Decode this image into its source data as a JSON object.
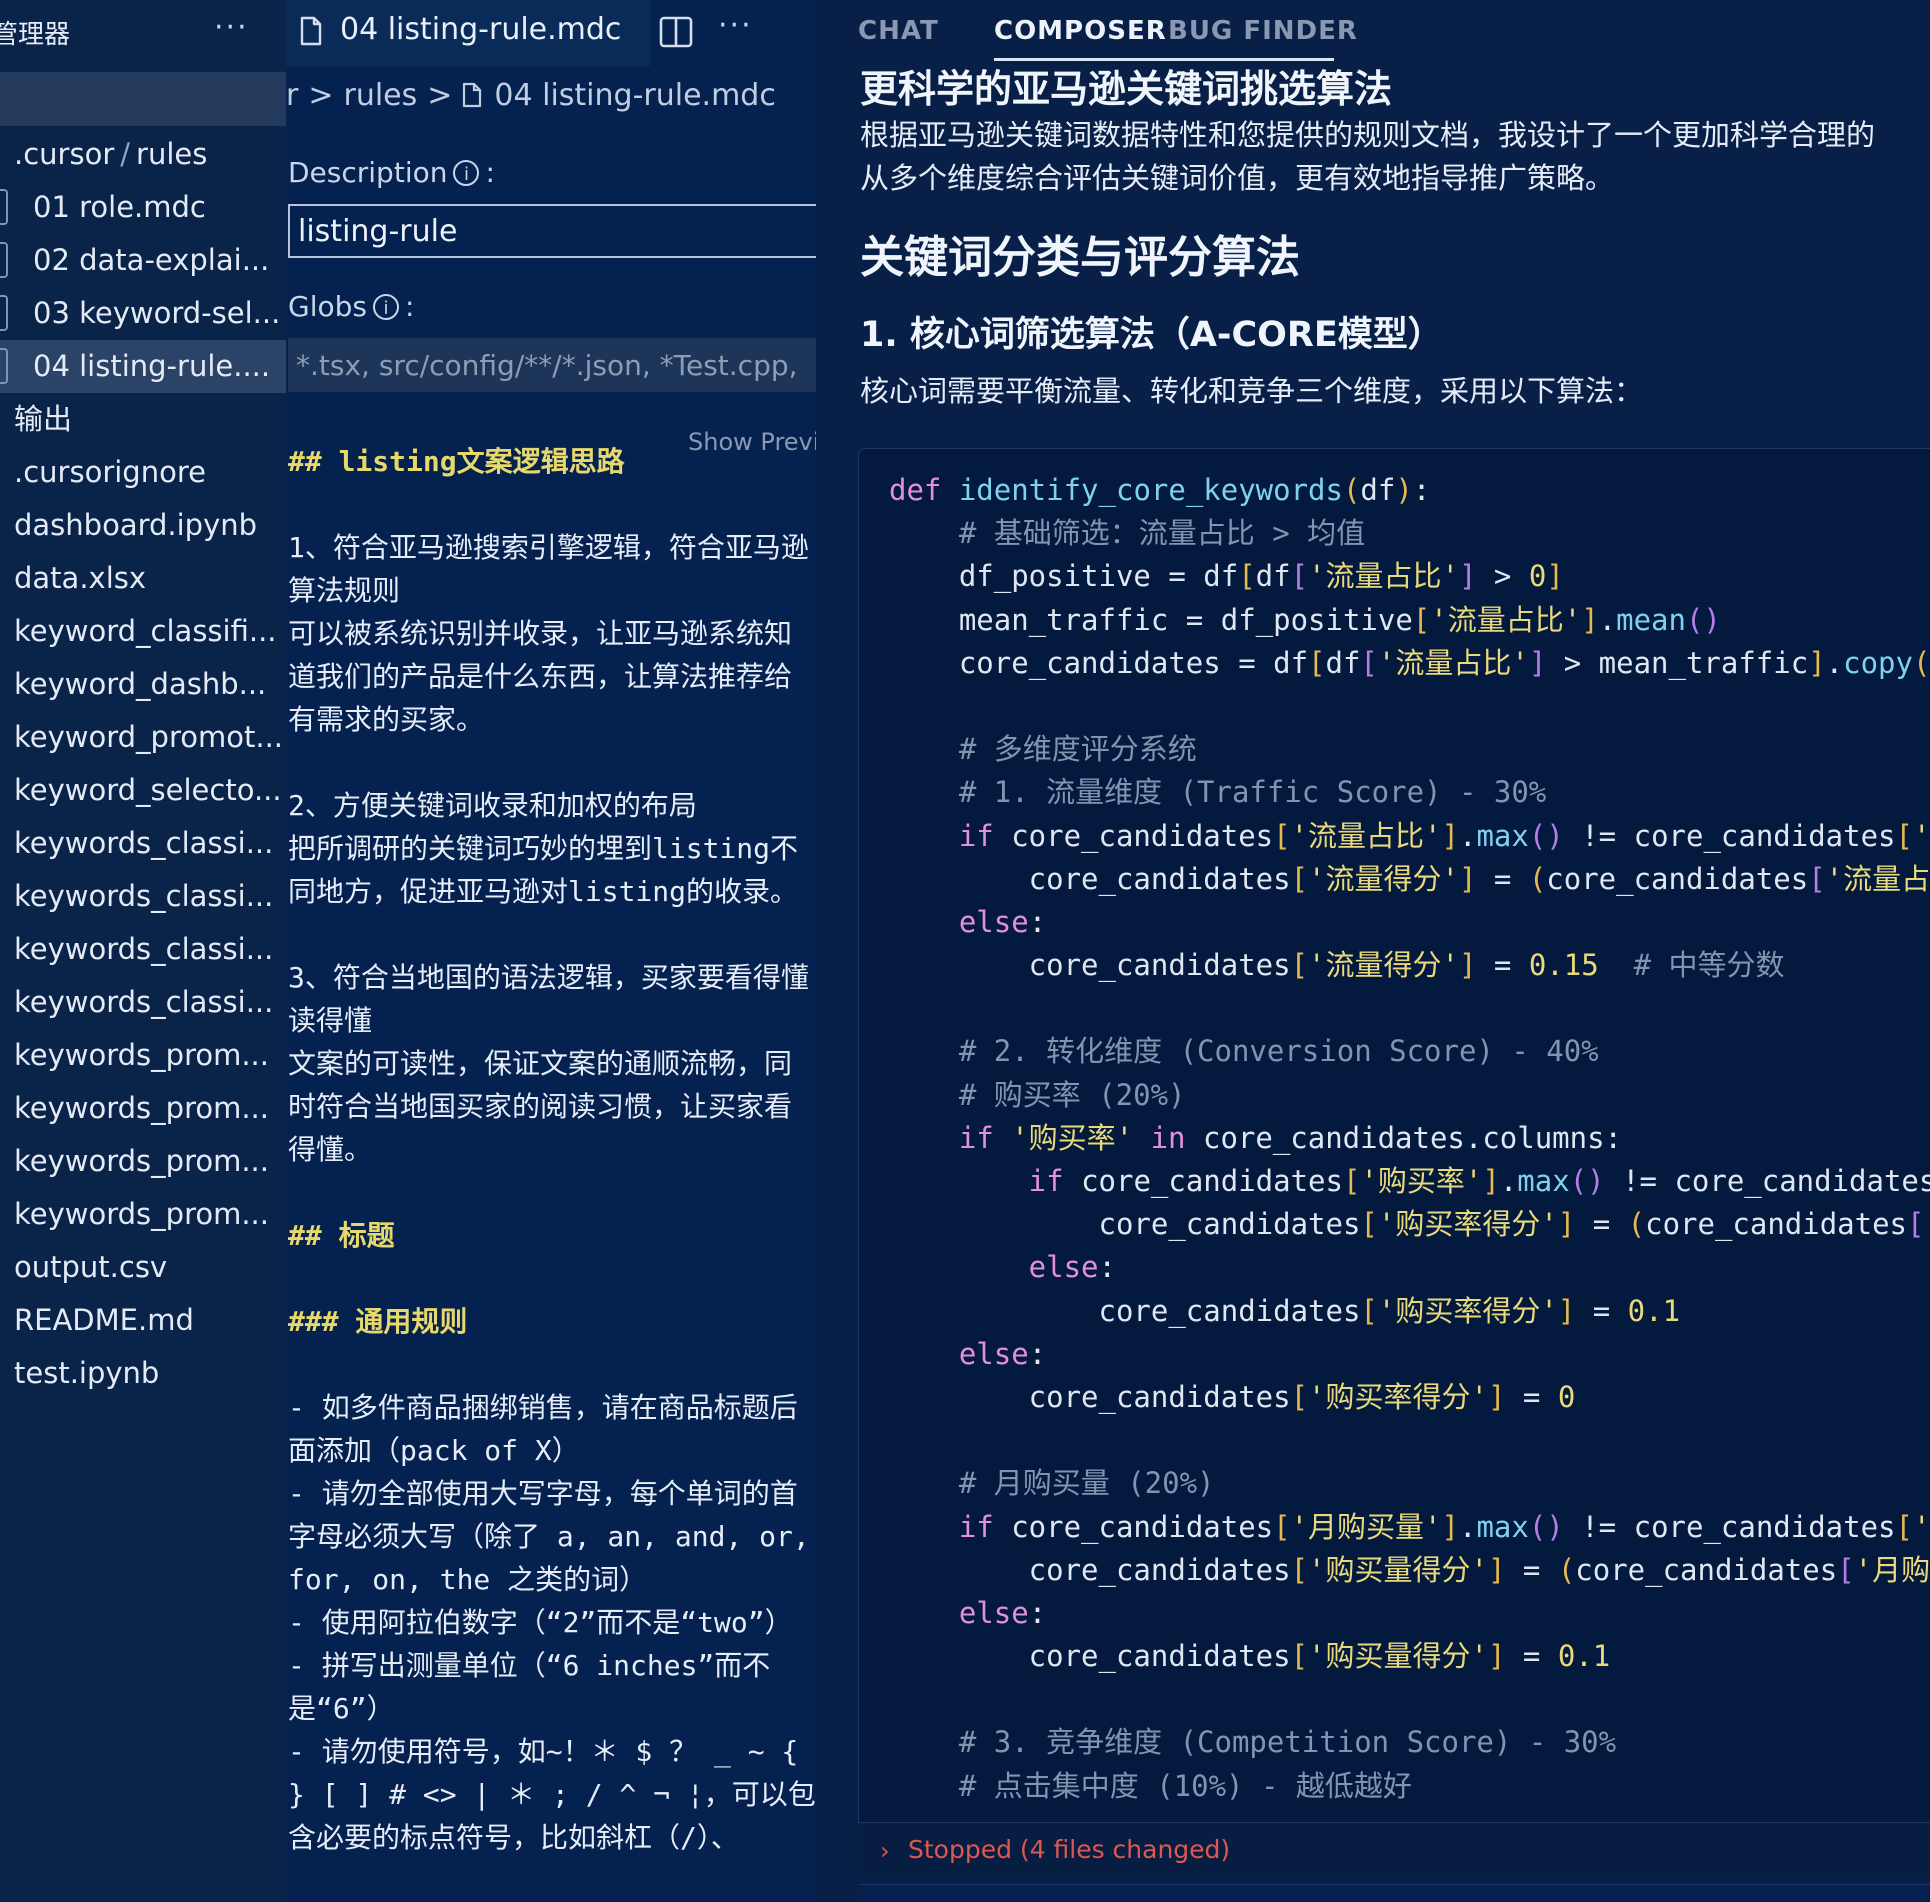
{
  "sidebar": {
    "title": "管理器",
    "more": "···",
    "tree": [
      {
        "label": ".cursor",
        "sep": "/",
        "label2": "rules",
        "type": "folder"
      },
      {
        "label": "01 role.mdc",
        "type": "child"
      },
      {
        "label": "02 data-explai...",
        "type": "child"
      },
      {
        "label": "03 keyword-sel...",
        "type": "child"
      },
      {
        "label": "04 listing-rule....",
        "type": "child",
        "selected": true
      },
      {
        "label": "输出",
        "type": "file"
      },
      {
        "label": ".cursorignore",
        "type": "file"
      },
      {
        "label": "dashboard.ipynb",
        "type": "file"
      },
      {
        "label": "data.xlsx",
        "type": "file"
      },
      {
        "label": "keyword_classifi...",
        "type": "file"
      },
      {
        "label": "keyword_dashb...",
        "type": "file"
      },
      {
        "label": "keyword_promot...",
        "type": "file"
      },
      {
        "label": "keyword_selecto...",
        "type": "file"
      },
      {
        "label": "keywords_classi...",
        "type": "file"
      },
      {
        "label": "keywords_classi...",
        "type": "file"
      },
      {
        "label": "keywords_classi...",
        "type": "file"
      },
      {
        "label": "keywords_classi...",
        "type": "file"
      },
      {
        "label": "keywords_prom...",
        "type": "file"
      },
      {
        "label": "keywords_prom...",
        "type": "file"
      },
      {
        "label": "keywords_prom...",
        "type": "file"
      },
      {
        "label": "keywords_prom...",
        "type": "file"
      },
      {
        "label": "output.csv",
        "type": "file"
      },
      {
        "label": "README.md",
        "type": "file"
      },
      {
        "label": "test.ipynb",
        "type": "file"
      }
    ]
  },
  "editor": {
    "tab_label": "04 listing-rule.mdc",
    "more": "···",
    "breadcrumb": [
      "r",
      ">",
      "rules",
      ">",
      "04 listing-rule.mdc"
    ],
    "description_label": "Description",
    "colon": ":",
    "description_value": "listing-rule",
    "globs_label": "Globs",
    "globs_placeholder": "*.tsx, src/config/**/*.json, *Test.cpp,",
    "show_preview": "Show Previ",
    "body": [
      {
        "kind": "h",
        "text": "## listing文案逻辑思路"
      },
      {
        "kind": "gap"
      },
      {
        "kind": "p",
        "text": "1、符合亚马逊搜索引擎逻辑，符合亚马逊算法规则"
      },
      {
        "kind": "p",
        "text": "可以被系统识别并收录，让亚马逊系统知道我们的产品是什么东西，让算法推荐给有需求的买家。"
      },
      {
        "kind": "gap"
      },
      {
        "kind": "p",
        "text": "2、方便关键词收录和加权的布局"
      },
      {
        "kind": "p",
        "text": "把所调研的关键词巧妙的埋到listing不同地方，促进亚马逊对listing的收录。"
      },
      {
        "kind": "gap"
      },
      {
        "kind": "p",
        "text": "3、符合当地国的语法逻辑，买家要看得懂读得懂"
      },
      {
        "kind": "p",
        "text": "文案的可读性，保证文案的通顺流畅，同时符合当地国买家的阅读习惯，让买家看得懂。"
      },
      {
        "kind": "gap"
      },
      {
        "kind": "h",
        "text": "## 标题"
      },
      {
        "kind": "gap"
      },
      {
        "kind": "h",
        "text": "### 通用规则"
      },
      {
        "kind": "gap"
      },
      {
        "kind": "p",
        "text": "- 如多件商品捆绑销售，请在商品标题后面添加（pack of X）"
      },
      {
        "kind": "p",
        "text": "- 请勿全部使用大写字母，每个单词的首字母必须大写（除了 a, an, and, or, for, on, the 之类的词）"
      },
      {
        "kind": "p",
        "text": "- 使用阿拉伯数字（“2”而不是“two”）"
      },
      {
        "kind": "p",
        "text": "- 拼写出测量单位（“6 inches”而不是“6”）"
      },
      {
        "kind": "p",
        "text": "- 请勿使用符号，如~！＊ $ ？ _ ~ { } [ ] # <> | ＊ ; / ^ ¬ ¦，可以包含必要的标点符号，比如斜杠（/）、"
      }
    ]
  },
  "panel": {
    "tabs": [
      "CHAT",
      "COMPOSER",
      "BUG FINDER"
    ],
    "active_tab": "COMPOSER",
    "title": "更科学的亚马逊关键词挑选算法",
    "intro_lines": [
      "根据亚马逊关键词数据特性和您提供的规则文档，我设计了一个更加科学合理的",
      "从多个维度综合评估关键词价值，更有效地指导推广策略。"
    ],
    "h2": "关键词分类与评分算法",
    "h3": "1. 核心词筛选算法（A-CORE模型）",
    "h3_intro": "核心词需要平衡流量、转化和竞争三个维度，采用以下算法：",
    "status": "Stopped (4 files changed)"
  },
  "code_lines": [
    [
      [
        "kw",
        "def "
      ],
      [
        "fn",
        "identify_core_keywords"
      ],
      [
        "brk",
        "("
      ],
      [
        "t",
        "df"
      ],
      [
        "brk",
        ")"
      ],
      [
        "t",
        ":"
      ]
    ],
    [
      [
        "cm",
        "    # 基础筛选：流量占比 > 均值"
      ]
    ],
    [
      [
        "t",
        "    df_positive = df"
      ],
      [
        "brk",
        "["
      ],
      [
        "t",
        "df"
      ],
      [
        "brk2",
        "["
      ],
      [
        "str",
        "'流量占比'"
      ],
      [
        "brk2",
        "]"
      ],
      [
        "t",
        " > "
      ],
      [
        "num",
        "0"
      ],
      [
        "brk",
        "]"
      ]
    ],
    [
      [
        "t",
        "    mean_traffic = df_positive"
      ],
      [
        "brk",
        "["
      ],
      [
        "str",
        "'流量占比'"
      ],
      [
        "brk",
        "]"
      ],
      [
        "t",
        "."
      ],
      [
        "fn",
        "mean"
      ],
      [
        "brk2",
        "()"
      ]
    ],
    [
      [
        "t",
        "    core_candidates = df"
      ],
      [
        "brk",
        "["
      ],
      [
        "t",
        "df"
      ],
      [
        "brk2",
        "["
      ],
      [
        "str",
        "'流量占比'"
      ],
      [
        "brk2",
        "]"
      ],
      [
        "t",
        " > mean_traffic"
      ],
      [
        "brk",
        "]"
      ],
      [
        "t",
        "."
      ],
      [
        "fn",
        "copy"
      ],
      [
        "brk",
        "("
      ]
    ],
    [
      [
        "t",
        ""
      ]
    ],
    [
      [
        "cm",
        "    # 多维度评分系统"
      ]
    ],
    [
      [
        "cm",
        "    # 1. 流量维度 (Traffic Score) - 30%"
      ]
    ],
    [
      [
        "kw",
        "    if "
      ],
      [
        "t",
        "core_candidates"
      ],
      [
        "brk",
        "["
      ],
      [
        "str",
        "'流量占比'"
      ],
      [
        "brk",
        "]"
      ],
      [
        "t",
        "."
      ],
      [
        "fn",
        "max"
      ],
      [
        "brk2",
        "()"
      ],
      [
        "t",
        " != core_candidates"
      ],
      [
        "brk",
        "["
      ],
      [
        "str",
        "'流"
      ]
    ],
    [
      [
        "t",
        "        core_candidates"
      ],
      [
        "brk",
        "["
      ],
      [
        "str",
        "'流量得分'"
      ],
      [
        "brk",
        "]"
      ],
      [
        "t",
        " = "
      ],
      [
        "brk",
        "("
      ],
      [
        "t",
        "core_candidates"
      ],
      [
        "brk2",
        "["
      ],
      [
        "str",
        "'流量占比"
      ]
    ],
    [
      [
        "kw",
        "    else"
      ],
      [
        "t",
        ":"
      ]
    ],
    [
      [
        "t",
        "        core_candidates"
      ],
      [
        "brk",
        "["
      ],
      [
        "str",
        "'流量得分'"
      ],
      [
        "brk",
        "]"
      ],
      [
        "t",
        " = "
      ],
      [
        "num",
        "0.15"
      ],
      [
        "cm",
        "  # 中等分数"
      ]
    ],
    [
      [
        "t",
        ""
      ]
    ],
    [
      [
        "cm",
        "    # 2. 转化维度 (Conversion Score) - 40%"
      ]
    ],
    [
      [
        "cm",
        "    # 购买率 (20%)"
      ]
    ],
    [
      [
        "kw",
        "    if "
      ],
      [
        "str",
        "'购买率'"
      ],
      [
        "kw",
        " in "
      ],
      [
        "t",
        "core_candidates.columns:"
      ]
    ],
    [
      [
        "kw",
        "        if "
      ],
      [
        "t",
        "core_candidates"
      ],
      [
        "brk",
        "["
      ],
      [
        "str",
        "'购买率'"
      ],
      [
        "brk",
        "]"
      ],
      [
        "t",
        "."
      ],
      [
        "fn",
        "max"
      ],
      [
        "brk2",
        "()"
      ],
      [
        "t",
        " != core_candidates"
      ]
    ],
    [
      [
        "t",
        "            core_candidates"
      ],
      [
        "brk",
        "["
      ],
      [
        "str",
        "'购买率得分'"
      ],
      [
        "brk",
        "]"
      ],
      [
        "t",
        " = "
      ],
      [
        "brk",
        "("
      ],
      [
        "t",
        "core_candidates"
      ],
      [
        "brk2",
        "["
      ],
      [
        "str",
        "'"
      ]
    ],
    [
      [
        "kw",
        "        else"
      ],
      [
        "t",
        ":"
      ]
    ],
    [
      [
        "t",
        "            core_candidates"
      ],
      [
        "brk",
        "["
      ],
      [
        "str",
        "'购买率得分'"
      ],
      [
        "brk",
        "]"
      ],
      [
        "t",
        " = "
      ],
      [
        "num",
        "0.1"
      ]
    ],
    [
      [
        "kw",
        "    else"
      ],
      [
        "t",
        ":"
      ]
    ],
    [
      [
        "t",
        "        core_candidates"
      ],
      [
        "brk",
        "["
      ],
      [
        "str",
        "'购买率得分'"
      ],
      [
        "brk",
        "]"
      ],
      [
        "t",
        " = "
      ],
      [
        "num",
        "0"
      ]
    ],
    [
      [
        "t",
        ""
      ]
    ],
    [
      [
        "cm",
        "    # 月购买量 (20%)"
      ]
    ],
    [
      [
        "kw",
        "    if "
      ],
      [
        "t",
        "core_candidates"
      ],
      [
        "brk",
        "["
      ],
      [
        "str",
        "'月购买量'"
      ],
      [
        "brk",
        "]"
      ],
      [
        "t",
        "."
      ],
      [
        "fn",
        "max"
      ],
      [
        "brk2",
        "()"
      ],
      [
        "t",
        " != core_candidates"
      ],
      [
        "brk",
        "["
      ],
      [
        "str",
        "'月"
      ]
    ],
    [
      [
        "t",
        "        core_candidates"
      ],
      [
        "brk",
        "["
      ],
      [
        "str",
        "'购买量得分'"
      ],
      [
        "brk",
        "]"
      ],
      [
        "t",
        " = "
      ],
      [
        "brk",
        "("
      ],
      [
        "t",
        "core_candidates"
      ],
      [
        "brk2",
        "["
      ],
      [
        "str",
        "'月购买"
      ]
    ],
    [
      [
        "kw",
        "    else"
      ],
      [
        "t",
        ":"
      ]
    ],
    [
      [
        "t",
        "        core_candidates"
      ],
      [
        "brk",
        "["
      ],
      [
        "str",
        "'购买量得分'"
      ],
      [
        "brk",
        "]"
      ],
      [
        "t",
        " = "
      ],
      [
        "num",
        "0.1"
      ]
    ],
    [
      [
        "t",
        ""
      ]
    ],
    [
      [
        "cm",
        "    # 3. 竞争维度 (Competition Score) - 30%"
      ]
    ],
    [
      [
        "cm",
        "    # 点击集中度 (10%) - 越低越好"
      ]
    ]
  ],
  "colors": {
    "background": "#04214f",
    "sidebar": "#0a2348",
    "keyword": "#e390d6",
    "function": "#7fd1ee",
    "string": "#e9d97a",
    "comment": "#8394b0",
    "status_red": "#e0574f"
  },
  "icons": [
    "file-icon",
    "split-editor-icon",
    "info-icon",
    "chevron-right-icon"
  ]
}
